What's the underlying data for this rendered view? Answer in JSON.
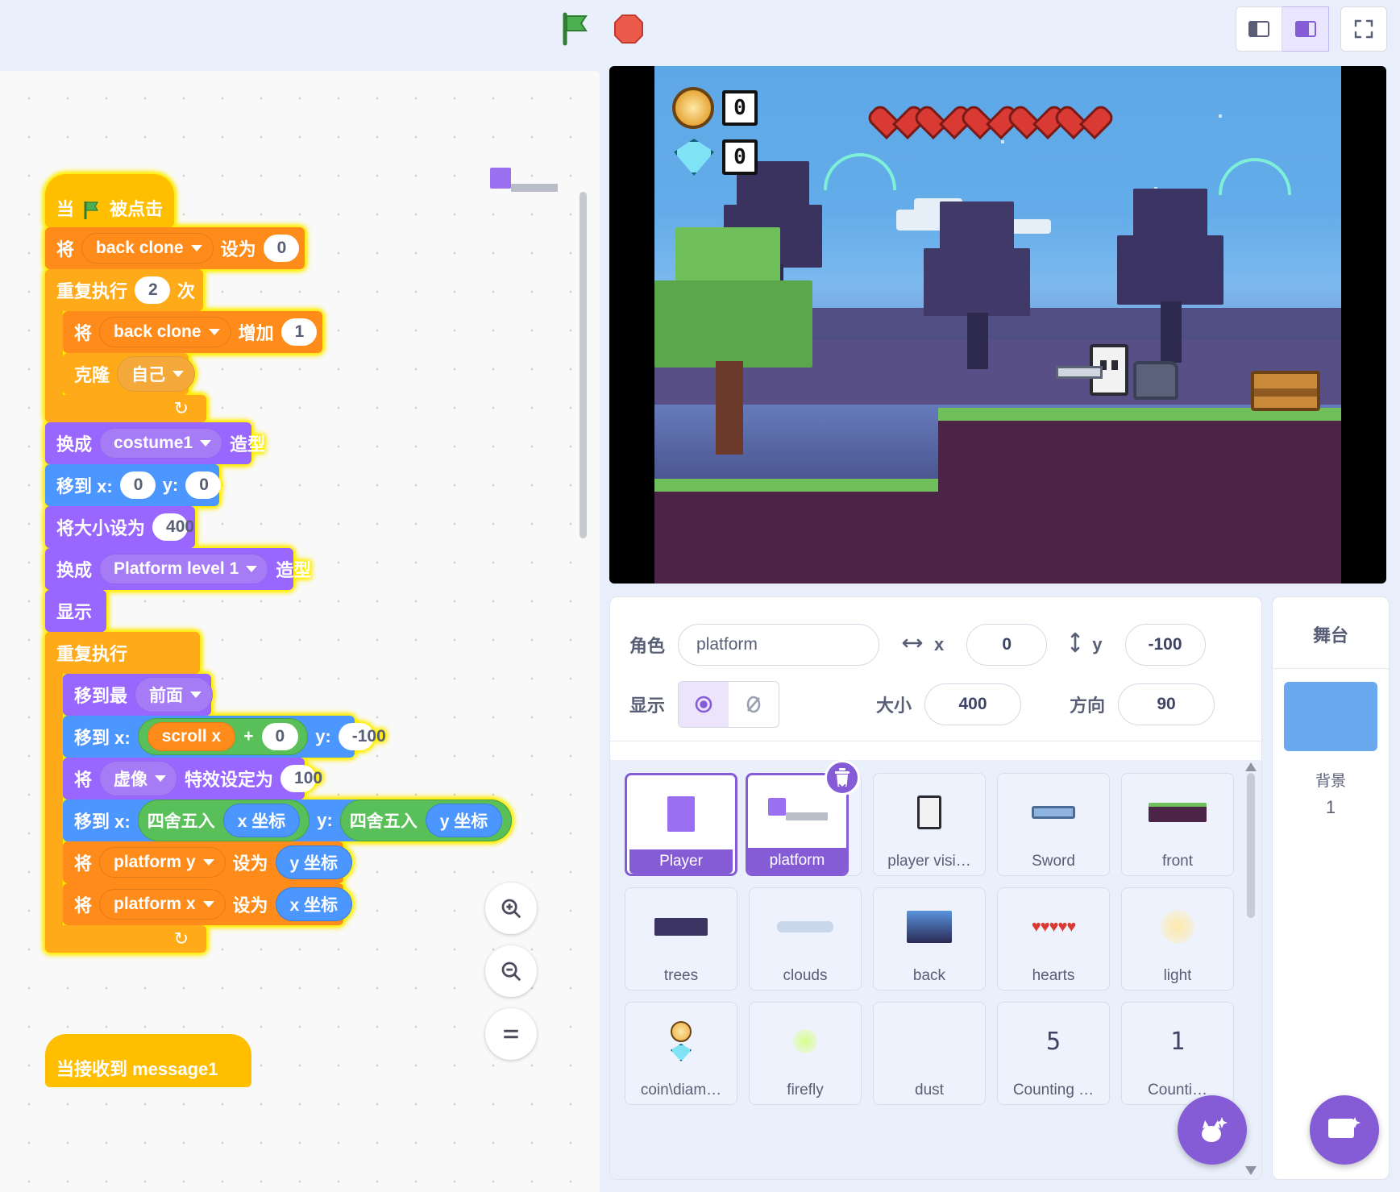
{
  "toolbar": {
    "green_flag": "green-flag-icon",
    "stop": "stop-icon",
    "layout_small": "layout-small-icon",
    "layout_large": "layout-large-icon",
    "fullscreen": "fullscreen-icon"
  },
  "code": {
    "script1": {
      "hat": {
        "when": "当",
        "flag": "green-flag-icon",
        "clicked": "被点击"
      },
      "set_back_clone": {
        "set": "将",
        "var": "back clone",
        "to": "设为",
        "value": "0"
      },
      "repeat": {
        "label": "重复执行",
        "times": "2",
        "suffix": "次"
      },
      "change_back_clone": {
        "set": "将",
        "var": "back clone",
        "to": "增加",
        "value": "1"
      },
      "clone": {
        "label": "克隆",
        "target": "自己"
      },
      "switch_costume1": {
        "prefix": "换成",
        "costume": "costume1",
        "suffix": "造型"
      },
      "goto_xy": {
        "prefix": "移到 x:",
        "x": "0",
        "ylabel": "y:",
        "y": "0"
      },
      "set_size": {
        "prefix": "将大小设为",
        "value": "400"
      },
      "switch_costume2": {
        "prefix": "换成",
        "costume": "Platform level 1",
        "suffix": "造型"
      },
      "show": {
        "label": "显示"
      },
      "forever": {
        "label": "重复执行"
      },
      "go_to_layer": {
        "prefix": "移到最",
        "layer": "前面"
      },
      "goto_scroll": {
        "prefix": "移到 x:",
        "var": "scroll x",
        "op": "+",
        "addend": "0",
        "ylabel": "y:",
        "y": "-100"
      },
      "set_effect": {
        "set": "将",
        "effect": "虚像",
        "to": "特效设定为",
        "value": "100"
      },
      "goto_round": {
        "prefix": "移到 x:",
        "round1": "四舍五入",
        "arg1": "x 坐标",
        "ylabel": "y:",
        "round2": "四舍五入",
        "arg2": "y 坐标"
      },
      "set_platform_y": {
        "set": "将",
        "var": "platform y",
        "to": "设为",
        "value": "y 坐标"
      },
      "set_platform_x": {
        "set": "将",
        "var": "platform x",
        "to": "设为",
        "value": "x 坐标"
      }
    },
    "script2": {
      "hat_partial": "当接收到 message1"
    }
  },
  "stage": {
    "hud": {
      "coin_icon": "coin-icon",
      "coin_count": "0",
      "gem_icon": "gem-icon",
      "gem_count": "0",
      "hearts": 5
    }
  },
  "sprite_info": {
    "name_label": "角色",
    "name_value": "platform",
    "x_label": "x",
    "x_value": "0",
    "y_label": "y",
    "y_value": "-100",
    "show_label": "显示",
    "show_on_icon": "eye-icon",
    "show_off_icon": "eye-slash-icon",
    "size_label": "大小",
    "size_value": "400",
    "direction_label": "方向",
    "direction_value": "90"
  },
  "sprites": [
    {
      "name": "Player",
      "thumb": "purple-square",
      "selected": false
    },
    {
      "name": "platform",
      "thumb": "platform-thumb",
      "selected": true
    },
    {
      "name": "player visi…",
      "thumb": "player-figure",
      "selected": false
    },
    {
      "name": "Sword",
      "thumb": "sword-thumb",
      "selected": false
    },
    {
      "name": "front",
      "thumb": "front-thumb",
      "selected": false
    },
    {
      "name": "trees",
      "thumb": "trees-thumb",
      "selected": false
    },
    {
      "name": "clouds",
      "thumb": "clouds-thumb",
      "selected": false
    },
    {
      "name": "back",
      "thumb": "back-thumb",
      "selected": false
    },
    {
      "name": "hearts",
      "thumb": "hearts-thumb",
      "selected": false
    },
    {
      "name": "light",
      "thumb": "light-thumb",
      "selected": false
    },
    {
      "name": "coin\\diam…",
      "thumb": "coin-gem-thumb",
      "selected": false
    },
    {
      "name": "firefly",
      "thumb": "firefly-thumb",
      "selected": false
    },
    {
      "name": "dust",
      "thumb": "dust-thumb",
      "selected": false
    },
    {
      "name": "Counting …",
      "thumb": "digit-5",
      "selected": false
    },
    {
      "name": "Counti…",
      "thumb": "digit-1",
      "selected": false
    }
  ],
  "sprite_panel": {
    "delete_icon": "trash-icon",
    "add_sprite_icon": "add-sprite-icon"
  },
  "stage_panel": {
    "title": "舞台",
    "subtitle": "背景",
    "count": "1",
    "add_backdrop_icon": "add-backdrop-icon"
  }
}
